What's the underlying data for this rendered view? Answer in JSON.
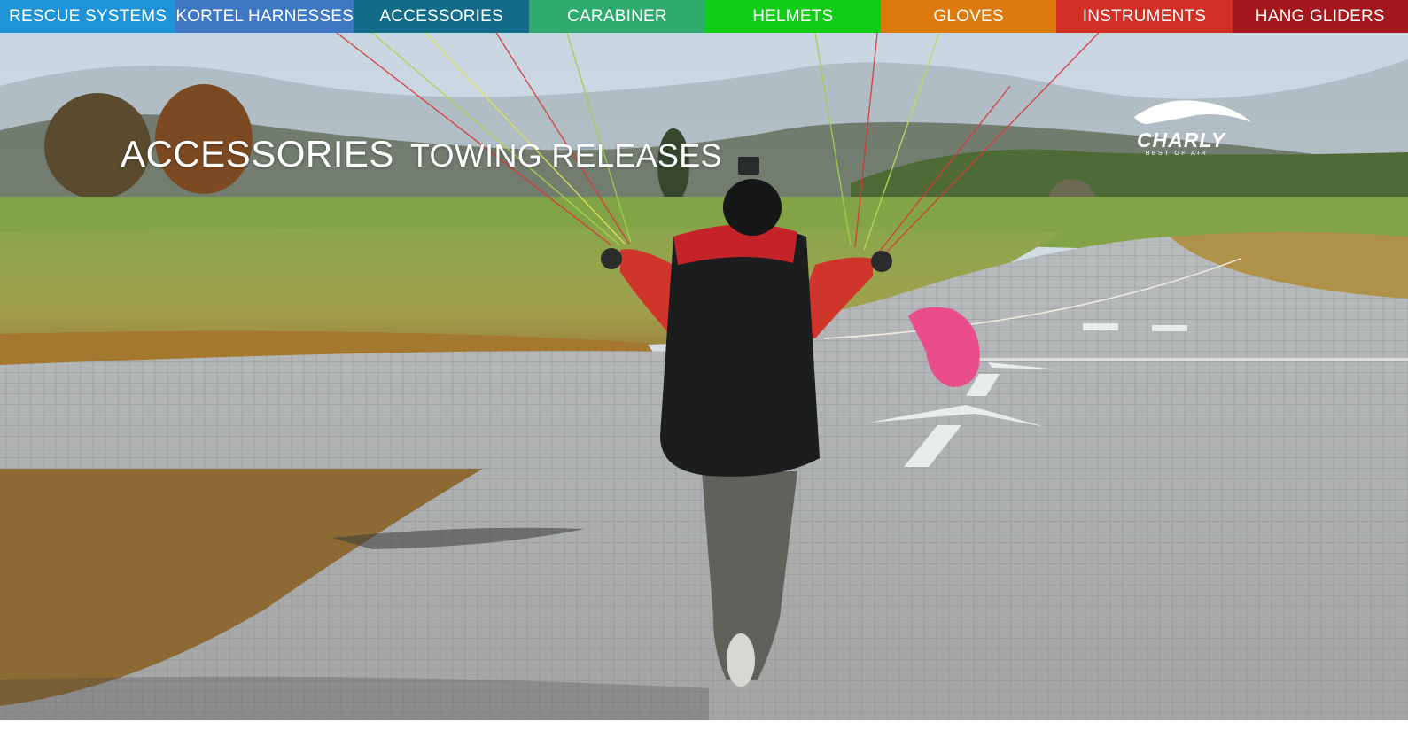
{
  "nav": {
    "items": [
      {
        "label": "RESCUE SYSTEMS",
        "color": "#1f93d8"
      },
      {
        "label": "KORTEL HARNESSES",
        "color": "#3e77c3"
      },
      {
        "label": "ACCESSORIES",
        "color": "#126b88"
      },
      {
        "label": "CARABINER",
        "color": "#2eaa6c"
      },
      {
        "label": "HELMETS",
        "color": "#11cd17"
      },
      {
        "label": "GLOVES",
        "color": "#dd7a0e"
      },
      {
        "label": "INSTRUMENTS",
        "color": "#d22f25"
      },
      {
        "label": "HANG GLIDERS",
        "color": "#a4161b"
      }
    ]
  },
  "hero": {
    "category": "ACCESSORIES",
    "subtitle": "TOWING RELEASES"
  },
  "logo": {
    "name": "CHARLY",
    "tagline": "BEST OF AIR",
    "icon": "charly-wing-logo-icon"
  }
}
